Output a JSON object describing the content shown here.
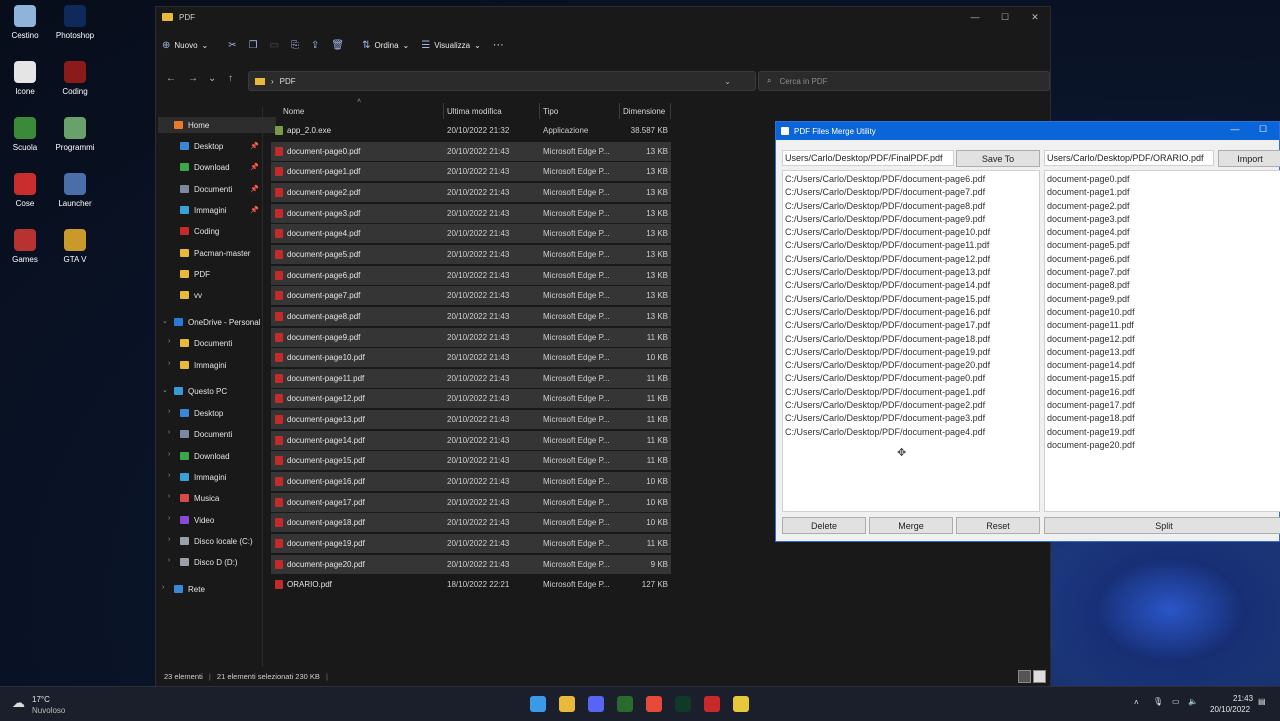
{
  "desktop": {
    "icons": [
      {
        "label": "Cestino",
        "icon": "recycle-bin-icon",
        "color": "#8fb3d9"
      },
      {
        "label": "Photoshop",
        "icon": "photoshop-icon",
        "color": "#0f2a5a"
      },
      {
        "label": "Icone",
        "icon": "folder-icon",
        "color": "#e5e5e5"
      },
      {
        "label": "Coding",
        "icon": "coding-icon",
        "color": "#8b1a1a"
      },
      {
        "label": "Scuola",
        "icon": "school-icon",
        "color": "#3a8a3a"
      },
      {
        "label": "Programmi",
        "icon": "programs-icon",
        "color": "#6aa06a"
      },
      {
        "label": "Cose",
        "icon": "popcorn-icon",
        "color": "#c92d2d"
      },
      {
        "label": "Launcher",
        "icon": "rocket-icon",
        "color": "#4a6fa8"
      },
      {
        "label": "Games",
        "icon": "games-icon",
        "color": "#b83232"
      },
      {
        "label": "GTA V",
        "icon": "gta-icon",
        "color": "#c99a2a"
      }
    ]
  },
  "explorer": {
    "title": "PDF",
    "toolbar": {
      "new": "Nuovo",
      "sort": "Ordina",
      "view": "Visualizza",
      "more": "···"
    },
    "address": {
      "path_sep": "›",
      "path": "PDF"
    },
    "search_placeholder": "Cerca in PDF",
    "sidebar": [
      {
        "label": "Home",
        "level": 0,
        "color": "#e87a2a",
        "selected": true,
        "chev": "⌄"
      },
      {
        "label": "Desktop",
        "level": 1,
        "color": "#3a86d8",
        "pin": true
      },
      {
        "label": "Download",
        "level": 1,
        "color": "#3aa84a",
        "pin": true
      },
      {
        "label": "Documenti",
        "level": 1,
        "color": "#7a8aa0",
        "pin": true
      },
      {
        "label": "Immagini",
        "level": 1,
        "color": "#3aa0d8",
        "pin": true
      },
      {
        "label": "Coding",
        "level": 1,
        "color": "#c82a2a"
      },
      {
        "label": "Pacman-master",
        "level": 1,
        "color": "#e8b93b"
      },
      {
        "label": "PDF",
        "level": 1,
        "color": "#e8b93b"
      },
      {
        "label": "vv",
        "level": 1,
        "color": "#e8b93b"
      },
      {
        "label": "OneDrive - Personal",
        "level": 0,
        "color": "#2a7ad8",
        "chev": "⌄"
      },
      {
        "label": "Documenti",
        "level": 1,
        "color": "#e8b93b",
        "chev": "›"
      },
      {
        "label": "Immagini",
        "level": 1,
        "color": "#e8b93b",
        "chev": "›"
      },
      {
        "label": "Questo PC",
        "level": 0,
        "color": "#3a9ad8",
        "chev": "⌄"
      },
      {
        "label": "Desktop",
        "level": 1,
        "color": "#3a86d8",
        "chev": "›"
      },
      {
        "label": "Documenti",
        "level": 1,
        "color": "#7a8aa0",
        "chev": "›"
      },
      {
        "label": "Download",
        "level": 1,
        "color": "#3aa84a",
        "chev": "›"
      },
      {
        "label": "Immagini",
        "level": 1,
        "color": "#3aa0d8",
        "chev": "›"
      },
      {
        "label": "Musica",
        "level": 1,
        "color": "#d84a4a",
        "chev": "›"
      },
      {
        "label": "Video",
        "level": 1,
        "color": "#8a4ad8",
        "chev": "›"
      },
      {
        "label": "Disco locale (C:)",
        "level": 1,
        "color": "#9aa0a8",
        "chev": "›"
      },
      {
        "label": "Disco D (D:)",
        "level": 1,
        "color": "#9aa0a8",
        "chev": "›"
      },
      {
        "label": "Rete",
        "level": 0,
        "color": "#3a86d8",
        "chev": "›"
      }
    ],
    "columns": {
      "name": "Nome",
      "modified": "Ultima modifica",
      "type": "Tipo",
      "size": "Dimensione"
    },
    "files": [
      {
        "name": "app_2.0.exe",
        "date": "20/10/2022 21:32",
        "type": "Applicazione",
        "size": "38.587 KB",
        "exe": true,
        "sel": false
      },
      {
        "name": "document-page0.pdf",
        "date": "20/10/2022 21:43",
        "type": "Microsoft Edge P...",
        "size": "13 KB",
        "sel": true
      },
      {
        "name": "document-page1.pdf",
        "date": "20/10/2022 21:43",
        "type": "Microsoft Edge P...",
        "size": "13 KB",
        "sel": true
      },
      {
        "name": "document-page2.pdf",
        "date": "20/10/2022 21:43",
        "type": "Microsoft Edge P...",
        "size": "13 KB",
        "sel": true
      },
      {
        "name": "document-page3.pdf",
        "date": "20/10/2022 21:43",
        "type": "Microsoft Edge P...",
        "size": "13 KB",
        "sel": true
      },
      {
        "name": "document-page4.pdf",
        "date": "20/10/2022 21:43",
        "type": "Microsoft Edge P...",
        "size": "13 KB",
        "sel": true
      },
      {
        "name": "document-page5.pdf",
        "date": "20/10/2022 21:43",
        "type": "Microsoft Edge P...",
        "size": "13 KB",
        "sel": true
      },
      {
        "name": "document-page6.pdf",
        "date": "20/10/2022 21:43",
        "type": "Microsoft Edge P...",
        "size": "13 KB",
        "sel": true
      },
      {
        "name": "document-page7.pdf",
        "date": "20/10/2022 21:43",
        "type": "Microsoft Edge P...",
        "size": "13 KB",
        "sel": true
      },
      {
        "name": "document-page8.pdf",
        "date": "20/10/2022 21:43",
        "type": "Microsoft Edge P...",
        "size": "13 KB",
        "sel": true
      },
      {
        "name": "document-page9.pdf",
        "date": "20/10/2022 21:43",
        "type": "Microsoft Edge P...",
        "size": "11 KB",
        "sel": true
      },
      {
        "name": "document-page10.pdf",
        "date": "20/10/2022 21:43",
        "type": "Microsoft Edge P...",
        "size": "10 KB",
        "sel": true
      },
      {
        "name": "document-page11.pdf",
        "date": "20/10/2022 21:43",
        "type": "Microsoft Edge P...",
        "size": "11 KB",
        "sel": true
      },
      {
        "name": "document-page12.pdf",
        "date": "20/10/2022 21:43",
        "type": "Microsoft Edge P...",
        "size": "11 KB",
        "sel": true
      },
      {
        "name": "document-page13.pdf",
        "date": "20/10/2022 21:43",
        "type": "Microsoft Edge P...",
        "size": "11 KB",
        "sel": true
      },
      {
        "name": "document-page14.pdf",
        "date": "20/10/2022 21:43",
        "type": "Microsoft Edge P...",
        "size": "11 KB",
        "sel": true
      },
      {
        "name": "document-page15.pdf",
        "date": "20/10/2022 21:43",
        "type": "Microsoft Edge P...",
        "size": "11 KB",
        "sel": true
      },
      {
        "name": "document-page16.pdf",
        "date": "20/10/2022 21:43",
        "type": "Microsoft Edge P...",
        "size": "10 KB",
        "sel": true
      },
      {
        "name": "document-page17.pdf",
        "date": "20/10/2022 21:43",
        "type": "Microsoft Edge P...",
        "size": "10 KB",
        "sel": true
      },
      {
        "name": "document-page18.pdf",
        "date": "20/10/2022 21:43",
        "type": "Microsoft Edge P...",
        "size": "10 KB",
        "sel": true
      },
      {
        "name": "document-page19.pdf",
        "date": "20/10/2022 21:43",
        "type": "Microsoft Edge P...",
        "size": "11 KB",
        "sel": true
      },
      {
        "name": "document-page20.pdf",
        "date": "20/10/2022 21:43",
        "type": "Microsoft Edge P...",
        "size": "9 KB",
        "sel": true
      },
      {
        "name": "ORARIO.pdf",
        "date": "18/10/2022 22:21",
        "type": "Microsoft Edge P...",
        "size": "127 KB",
        "sel": false
      }
    ],
    "status": {
      "count": "23 elementi",
      "selected": "21 elementi selezionati  230 KB"
    }
  },
  "merge": {
    "title": "PDF Files Merge Utility",
    "output_path": "Users/Carlo/Desktop/PDF/FinalPDF.pdf",
    "save_to": "Save To",
    "import_path": "Users/Carlo/Desktop/PDF/ORARIO.pdf",
    "import": "Import",
    "merge_list": [
      "C:/Users/Carlo/Desktop/PDF/document-page6.pdf",
      "C:/Users/Carlo/Desktop/PDF/document-page7.pdf",
      "C:/Users/Carlo/Desktop/PDF/document-page8.pdf",
      "C:/Users/Carlo/Desktop/PDF/document-page9.pdf",
      "C:/Users/Carlo/Desktop/PDF/document-page10.pdf",
      "C:/Users/Carlo/Desktop/PDF/document-page11.pdf",
      "C:/Users/Carlo/Desktop/PDF/document-page12.pdf",
      "C:/Users/Carlo/Desktop/PDF/document-page13.pdf",
      "C:/Users/Carlo/Desktop/PDF/document-page14.pdf",
      "C:/Users/Carlo/Desktop/PDF/document-page15.pdf",
      "C:/Users/Carlo/Desktop/PDF/document-page16.pdf",
      "C:/Users/Carlo/Desktop/PDF/document-page17.pdf",
      "C:/Users/Carlo/Desktop/PDF/document-page18.pdf",
      "C:/Users/Carlo/Desktop/PDF/document-page19.pdf",
      "C:/Users/Carlo/Desktop/PDF/document-page20.pdf",
      "C:/Users/Carlo/Desktop/PDF/document-page0.pdf",
      "C:/Users/Carlo/Desktop/PDF/document-page1.pdf",
      "C:/Users/Carlo/Desktop/PDF/document-page2.pdf",
      "C:/Users/Carlo/Desktop/PDF/document-page3.pdf",
      "C:/Users/Carlo/Desktop/PDF/document-page4.pdf"
    ],
    "split_list": [
      "document-page0.pdf",
      "document-page1.pdf",
      "document-page2.pdf",
      "document-page3.pdf",
      "document-page4.pdf",
      "document-page5.pdf",
      "document-page6.pdf",
      "document-page7.pdf",
      "document-page8.pdf",
      "document-page9.pdf",
      "document-page10.pdf",
      "document-page11.pdf",
      "document-page12.pdf",
      "document-page13.pdf",
      "document-page14.pdf",
      "document-page15.pdf",
      "document-page16.pdf",
      "document-page17.pdf",
      "document-page18.pdf",
      "document-page19.pdf",
      "document-page20.pdf"
    ],
    "buttons": {
      "delete": "Delete",
      "merge": "Merge",
      "reset": "Reset",
      "split": "Split"
    }
  },
  "taskbar": {
    "weather_temp": "17°C",
    "weather_desc": "Nuvoloso",
    "time": "21:43",
    "date": "20/10/2022",
    "apps": [
      {
        "name": "start-icon",
        "color": "#3a9ae8"
      },
      {
        "name": "file-explorer-icon",
        "color": "#e8b93b"
      },
      {
        "name": "discord-icon",
        "color": "#5865f2"
      },
      {
        "name": "vim-icon",
        "color": "#2a6a2a"
      },
      {
        "name": "chrome-icon",
        "color": "#e84a3a"
      },
      {
        "name": "photoshop-icon",
        "color": "#0f3a2a"
      },
      {
        "name": "coding-icon",
        "color": "#c82a2a"
      },
      {
        "name": "python-app-icon",
        "color": "#e8c83a"
      }
    ]
  }
}
